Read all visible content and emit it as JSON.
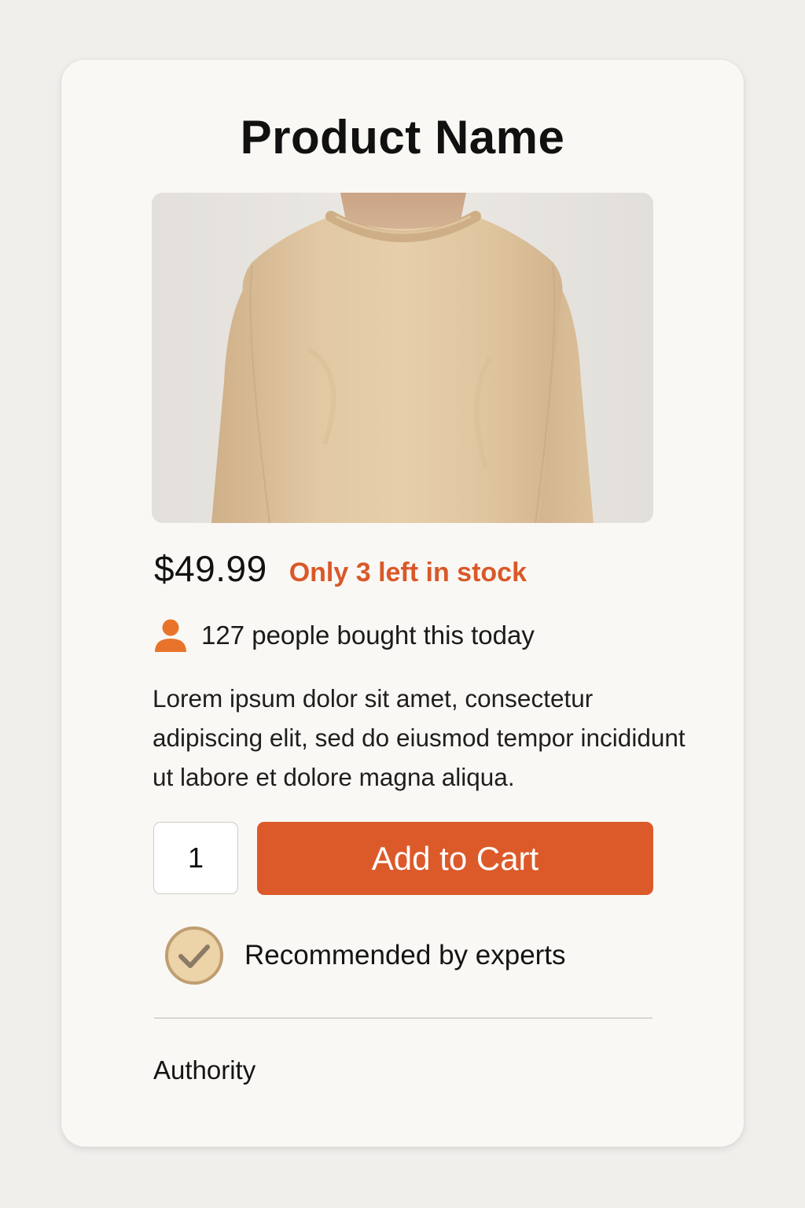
{
  "product": {
    "title": "Product Name",
    "image_alt": "Beige crewneck sweater worn by model",
    "price": "$49.99",
    "stock_notice": "Only 3 left in stock",
    "social_proof": "127 people bought this today",
    "description": "Lorem ipsum dolor sit amet, consectetur adipiscing elit, sed do eiusmod tempor incididunt ut labore et dolore magna aliqua."
  },
  "cart": {
    "quantity": "1",
    "add_label": "Add to Cart"
  },
  "badge": {
    "label": "Recommended by experts"
  },
  "footer": {
    "label": "Authority"
  },
  "icons": {
    "social": "person-icon",
    "badge": "checkmark-icon"
  },
  "colors": {
    "accent": "#dc5a2a",
    "stock_text": "#d9582a",
    "person_icon": "#e8742c",
    "check_badge": "#ecd3a8",
    "card_background": "#faf8f4",
    "page_background": "#f1efec"
  }
}
